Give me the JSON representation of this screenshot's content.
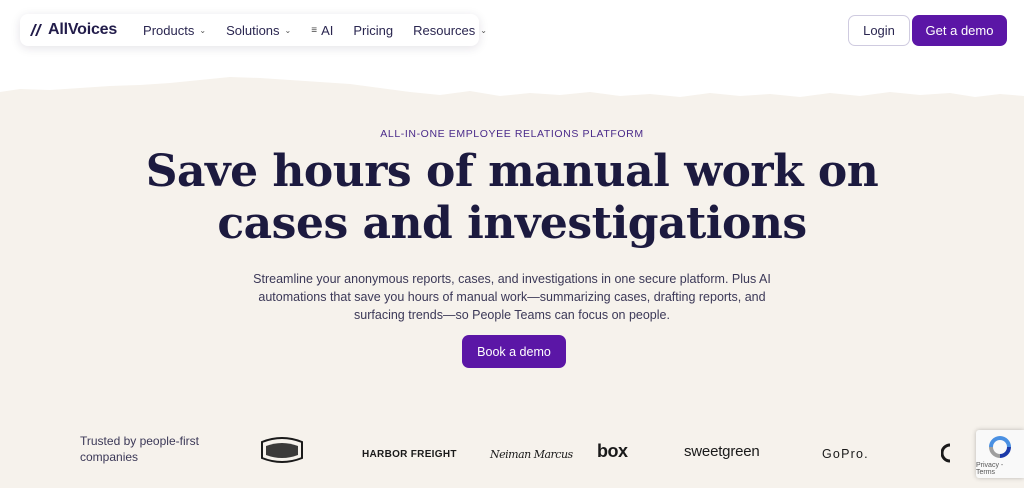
{
  "nav": {
    "logo_text": "AllVoices",
    "items": [
      {
        "label": "Products",
        "has_chevron": true
      },
      {
        "label": "Solutions",
        "has_chevron": true
      },
      {
        "label": "AI",
        "has_chevron": false
      },
      {
        "label": "Pricing",
        "has_chevron": false
      },
      {
        "label": "Resources",
        "has_chevron": true
      }
    ],
    "login_label": "Login",
    "demo_label": "Get a demo"
  },
  "hero": {
    "eyebrow": "ALL-IN-ONE EMPLOYEE RELATIONS PLATFORM",
    "headline_line1": "Save hours of manual work on",
    "headline_line2": "cases and investigations",
    "subtext": "Streamline your anonymous reports, cases, and investigations in one secure platform. Plus AI automations that save you hours of manual work—summarizing cases, drafting reports, and surfacing trends—so People Teams can focus on people.",
    "cta_label": "Book a demo"
  },
  "trusted": {
    "label": "Trusted by people-first companies",
    "logos": {
      "cracker_barrel": "Cracker Barrel",
      "harbor_freight": "HARBOR FREIGHT",
      "neiman_marcus": "Neiman Marcus",
      "box": "box",
      "sweetgreen": "sweetgreen",
      "gopro": "GoPro."
    }
  },
  "recaptcha": {
    "footer": "Privacy - Terms"
  },
  "colors": {
    "accent": "#5b16a6",
    "page_bg": "#f6f2ec",
    "heading": "#1c1a3f"
  }
}
